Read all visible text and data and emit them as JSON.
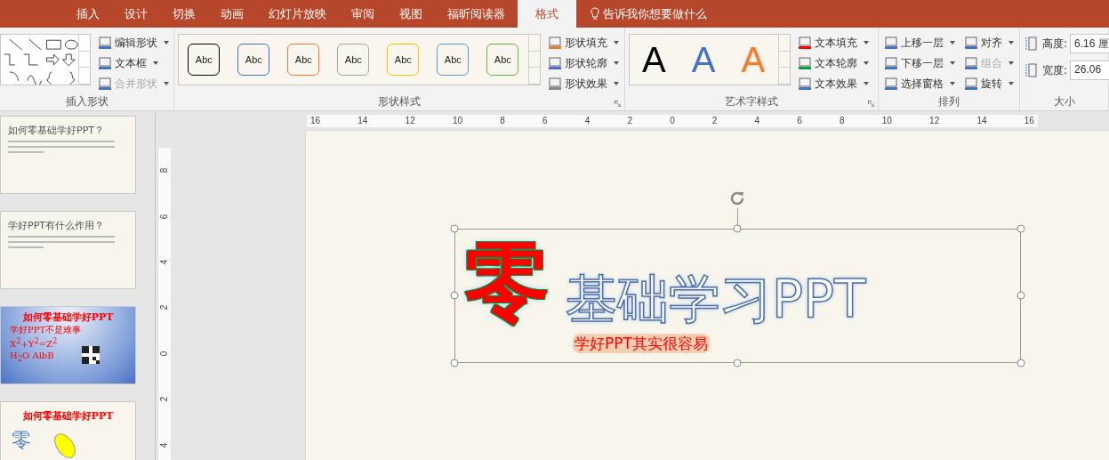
{
  "tabs": [
    {
      "label": "插入",
      "selected": false
    },
    {
      "label": "设计",
      "selected": false
    },
    {
      "label": "切换",
      "selected": false
    },
    {
      "label": "动画",
      "selected": false
    },
    {
      "label": "幻灯片放映",
      "selected": false
    },
    {
      "label": "审阅",
      "selected": false
    },
    {
      "label": "视图",
      "selected": false
    },
    {
      "label": "福昕阅读器",
      "selected": false
    },
    {
      "label": "格式",
      "selected": true
    }
  ],
  "tell_me": {
    "text": "告诉我你想要做什么"
  },
  "ribbon": {
    "groups": [
      {
        "kind": "shapes",
        "label": "插入形状",
        "commands": [
          {
            "label": "编辑形状",
            "disabled": false
          },
          {
            "label": "文本框",
            "disabled": false
          },
          {
            "label": "合并形状",
            "disabled": true
          }
        ]
      },
      {
        "kind": "styles",
        "label": "形状样式",
        "gallery": [
          {
            "label": "Abc",
            "color": "#000000"
          },
          {
            "label": "Abc",
            "color": "#4472c4"
          },
          {
            "label": "Abc",
            "color": "#ed7d31"
          },
          {
            "label": "Abc",
            "color": "#a5a5a5"
          },
          {
            "label": "Abc",
            "color": "#ffc000"
          },
          {
            "label": "Abc",
            "color": "#5b9bd5"
          },
          {
            "label": "Abc",
            "color": "#70ad47"
          }
        ],
        "commands": [
          {
            "label": "形状填充",
            "disabled": false
          },
          {
            "label": "形状轮廓",
            "disabled": false
          },
          {
            "label": "形状效果",
            "disabled": false
          }
        ]
      },
      {
        "kind": "wordart",
        "label": "艺术字样式",
        "gallery": [
          {
            "label": "A",
            "color": "#000000",
            "kind": "fill"
          },
          {
            "label": "A",
            "color": "#4472c4",
            "kind": "fill"
          },
          {
            "label": "A",
            "color": "#ed7d31",
            "kind": "outline"
          }
        ],
        "commands": [
          {
            "label": "文本填充",
            "disabled": false
          },
          {
            "label": "文本轮廓",
            "disabled": false
          },
          {
            "label": "文本效果",
            "disabled": false
          }
        ]
      },
      {
        "kind": "arrange",
        "label": "排列",
        "commands": [
          {
            "label": "上移一层",
            "disabled": false
          },
          {
            "label": "下移一层",
            "disabled": false
          },
          {
            "label": "选择窗格",
            "disabled": false
          },
          {
            "label": "对齐",
            "disabled": false
          },
          {
            "label": "组合",
            "disabled": true
          },
          {
            "label": "旋转",
            "disabled": false
          }
        ]
      },
      {
        "kind": "size",
        "label": "大小",
        "fields": [
          {
            "label": "高度:",
            "value": "6.16 厘"
          },
          {
            "label": "宽度:",
            "value": "26.06"
          }
        ]
      }
    ]
  },
  "thumbnails": [
    {
      "kind": "plain",
      "title": "如何零基础学好PPT？"
    },
    {
      "kind": "plain",
      "title": "学好PPT有什么作用？"
    },
    {
      "kind": "blue",
      "title": "如何零基础学好PPT",
      "lines": [
        "学好PPT不是难事",
        "X$^{2}$+Y$^{2}$=Z$^{2}$",
        "H$_{2}$O  AlbB"
      ]
    },
    {
      "kind": "art",
      "title": "如何零基础学好PPT",
      "big": "零"
    }
  ],
  "rulers": {
    "horizontal": [
      "16",
      "14",
      "12",
      "10",
      "8",
      "6",
      "4",
      "2",
      "0",
      "2",
      "4",
      "6",
      "8",
      "10",
      "12",
      "14",
      "16"
    ],
    "vertical": [
      "8",
      "6",
      "4",
      "2",
      "0",
      "2",
      "4"
    ]
  },
  "slide": {
    "big_char": "零",
    "title": "基础学习PPT",
    "overlay_text": "学好PPT其实很容易"
  }
}
